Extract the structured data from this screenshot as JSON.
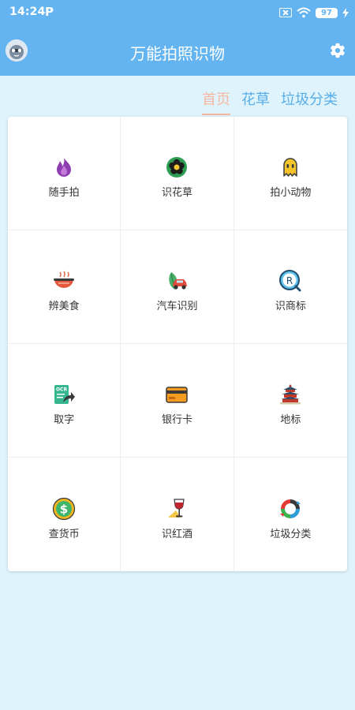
{
  "statusbar": {
    "time": "14:24",
    "p_label": "P",
    "battery": "97"
  },
  "header": {
    "title": "万能拍照识物"
  },
  "tabs": [
    {
      "label": "首页",
      "active": true
    },
    {
      "label": "花草",
      "active": false
    },
    {
      "label": "垃圾分类",
      "active": false
    }
  ],
  "grid": {
    "items": [
      {
        "label": "随手拍",
        "icon": "flame-icon"
      },
      {
        "label": "识花草",
        "icon": "flower-icon"
      },
      {
        "label": "拍小动物",
        "icon": "ghost-icon"
      },
      {
        "label": "辨美食",
        "icon": "noodle-bowl-icon"
      },
      {
        "label": "汽车识别",
        "icon": "car-leaf-icon"
      },
      {
        "label": "识商标",
        "icon": "registered-trademark-icon"
      },
      {
        "label": "取字",
        "icon": "ocr-icon"
      },
      {
        "label": "银行卡",
        "icon": "bank-card-icon"
      },
      {
        "label": "地标",
        "icon": "temple-icon"
      },
      {
        "label": "查货币",
        "icon": "dollar-coin-icon"
      },
      {
        "label": "识红酒",
        "icon": "wine-glass-icon"
      },
      {
        "label": "垃圾分类",
        "icon": "recycle-icon"
      }
    ]
  },
  "colors": {
    "header_bg": "#63b4f0",
    "page_bg": "#dff3fd",
    "tab_active": "#f6b8a2",
    "tab_inactive": "#58aee8"
  }
}
